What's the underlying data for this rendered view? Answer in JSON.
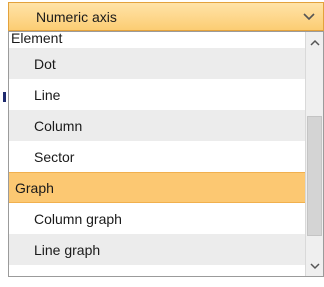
{
  "combo": {
    "selected_value": "Numeric axis",
    "arrow_icon": "chevron-down-icon",
    "accent_color": "#fccd73"
  },
  "list": {
    "groups": [
      {
        "label": "Element",
        "items": [
          "Dot",
          "Line",
          "Column",
          "Sector"
        ]
      },
      {
        "label": "Graph",
        "selected": true,
        "items": [
          "Column graph",
          "Line graph"
        ]
      }
    ],
    "selected_color": "#fcc872"
  },
  "scrollbar": {
    "up_icon": "chevron-up-icon",
    "down_icon": "chevron-down-icon"
  }
}
